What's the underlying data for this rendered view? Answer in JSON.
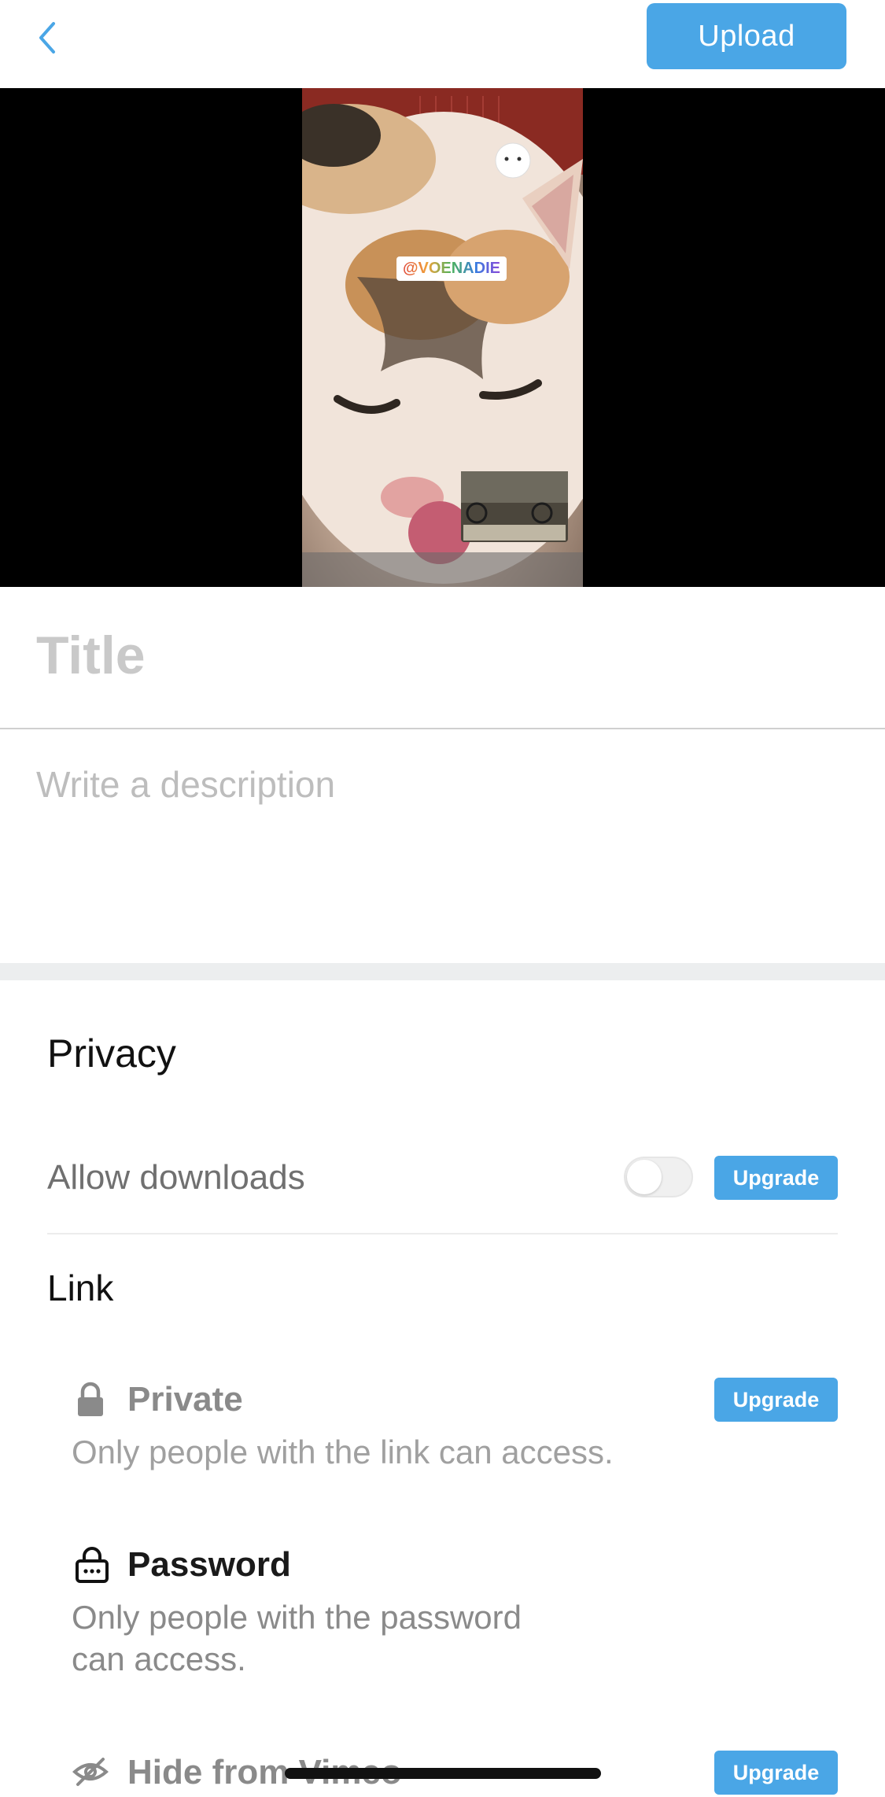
{
  "header": {
    "upload_label": "Upload"
  },
  "video": {
    "overlay_tag": "@VOENADIE"
  },
  "form": {
    "title_placeholder": "Title",
    "description_placeholder": "Write a description"
  },
  "privacy": {
    "section_title": "Privacy",
    "allow_downloads": {
      "label": "Allow downloads",
      "toggle_on": false,
      "upgrade_label": "Upgrade"
    },
    "link_title": "Link",
    "options": [
      {
        "title": "Private",
        "description": "Only people with the link can access.",
        "icon": "lock-icon",
        "upgrade_label": "Upgrade"
      },
      {
        "title": "Password",
        "description_line1": "Only people with the password",
        "description_line2": "can access.",
        "icon": "password-lock-icon"
      },
      {
        "title": "Hide from Vimeo",
        "icon": "eye-slash-icon",
        "upgrade_label": "Upgrade"
      }
    ]
  },
  "colors": {
    "accent": "#4aa6e6",
    "placeholder": "#c9c9c9",
    "section_gap": "#eceeef"
  }
}
